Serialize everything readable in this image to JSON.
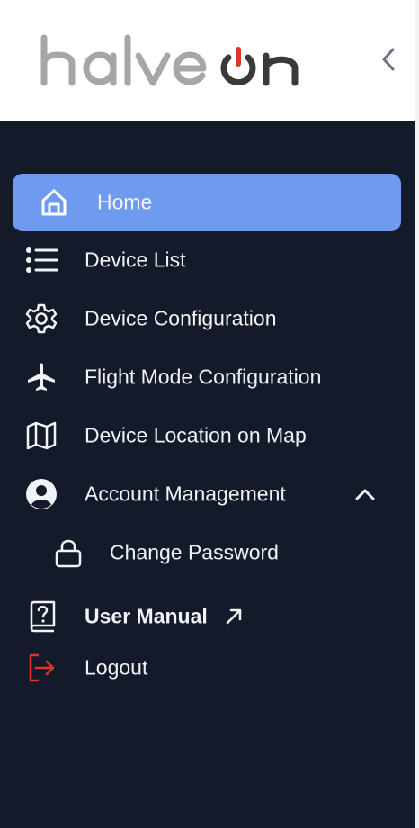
{
  "brand": {
    "logo_text": "halveon",
    "accent_color": "#e0342a"
  },
  "header": {
    "collapse_icon": "chevron-left-icon"
  },
  "colors": {
    "sidebar_bg": "#131a29",
    "active_bg": "#6e9af0",
    "text": "#f1f3f7",
    "logout_icon": "#e0342a"
  },
  "nav": {
    "home": {
      "label": "Home",
      "icon": "home-icon",
      "active": true
    },
    "device_list": {
      "label": "Device List",
      "icon": "list-icon"
    },
    "device_configuration": {
      "label": "Device Configuration",
      "icon": "gear-icon"
    },
    "flight_mode_configuration": {
      "label": "Flight Mode Configuration",
      "icon": "airplane-icon"
    },
    "device_location": {
      "label": "Device Location on Map",
      "icon": "map-icon"
    },
    "account_management": {
      "label": "Account Management",
      "icon": "user-circle-icon",
      "expanded": true,
      "toggle_icon": "chevron-up-icon"
    },
    "change_password": {
      "label": "Change Password",
      "icon": "lock-icon"
    },
    "user_manual": {
      "label": "User Manual",
      "icon": "help-book-icon",
      "link_icon": "external-link-icon"
    },
    "logout": {
      "label": "Logout",
      "icon": "logout-icon"
    }
  }
}
